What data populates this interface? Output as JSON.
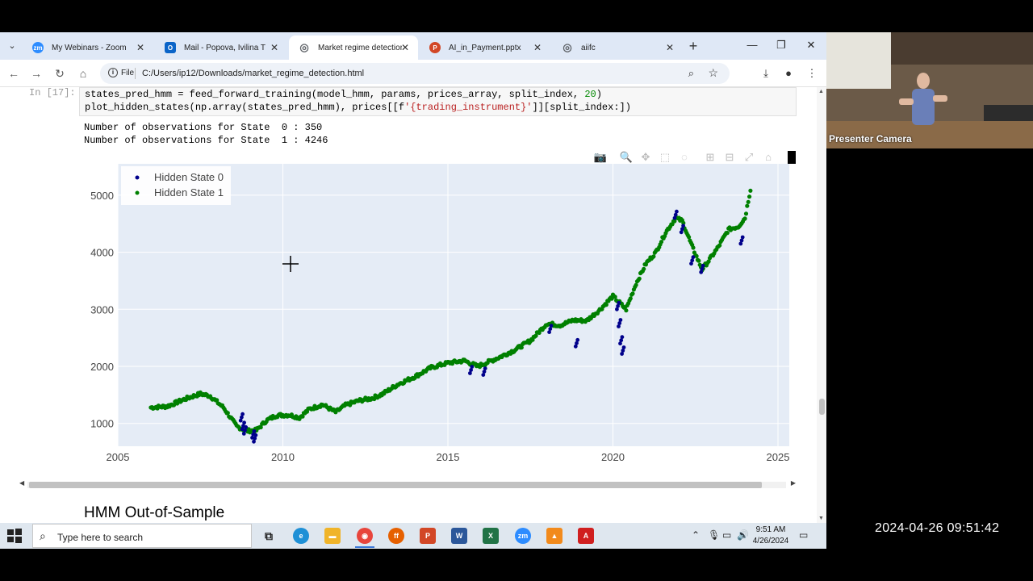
{
  "browser": {
    "tabs": [
      {
        "title": "My Webinars - Zoom",
        "icon": "zoom-icon",
        "color": "#2d8cff",
        "glyph": "zm"
      },
      {
        "title": "Mail - Popova, Ivilina T -",
        "icon": "outlook-icon",
        "color": "#0a64c8",
        "glyph": "O"
      },
      {
        "title": "Market regime detection",
        "icon": "globe-icon",
        "color": "#5f6368",
        "glyph": "◎",
        "active": true
      },
      {
        "title": "AI_in_Payment.pptx",
        "icon": "powerpoint-icon",
        "color": "#d24726",
        "glyph": "P"
      },
      {
        "title": "aiifc",
        "icon": "globe-icon",
        "color": "#5f6368",
        "glyph": "◎"
      }
    ],
    "site_label": "File",
    "url": "C:/Users/ip12/Downloads/market_regime_detection.html"
  },
  "notebook": {
    "prompt": "In [17]:",
    "code_line1_a": "states_pred_hmm = feed_forward_training(model_hmm, params, prices_array, split_index, ",
    "code_line1_num": "20",
    "code_line1_b": ")",
    "code_line2_a": "plot_hidden_states(np.array(states_pred_hmm), prices[[f",
    "code_line2_str": "'{trading_instrument}'",
    "code_line2_b": "]][split_index:])",
    "output": [
      "Number of observations for State  0 : 350",
      "Number of observations for State  1 : 4246"
    ],
    "section_heading": "HMM Out-of-Sample"
  },
  "chart_data": {
    "type": "scatter",
    "title": "",
    "xlabel": "",
    "ylabel": "",
    "xlim": [
      2005,
      2025
    ],
    "ylim": [
      600,
      5550
    ],
    "x_ticks": [
      "2005",
      "2010",
      "2015",
      "2020",
      "2025"
    ],
    "y_ticks": [
      "1000",
      "2000",
      "3000",
      "4000",
      "5000"
    ],
    "grid": true,
    "legend_position": "top-left",
    "series": [
      {
        "name": "Hidden State 1",
        "color": "#008000",
        "x": [
          2006.0,
          2006.5,
          2007.0,
          2007.5,
          2007.8,
          2008.2,
          2008.6,
          2008.9,
          2009.2,
          2009.5,
          2009.8,
          2010.2,
          2010.5,
          2010.8,
          2011.2,
          2011.6,
          2011.9,
          2012.3,
          2012.7,
          2013.0,
          2013.5,
          2014.0,
          2014.5,
          2015.0,
          2015.5,
          2015.9,
          2016.2,
          2016.6,
          2017.0,
          2017.5,
          2018.0,
          2018.4,
          2018.8,
          2019.2,
          2019.6,
          2020.0,
          2020.4,
          2020.7,
          2021.0,
          2021.3,
          2021.6,
          2021.9,
          2022.1,
          2022.4,
          2022.7,
          2022.9,
          2023.2,
          2023.5,
          2023.8,
          2024.0,
          2024.2
        ],
        "y": [
          1280,
          1300,
          1420,
          1520,
          1480,
          1280,
          950,
          870,
          880,
          1050,
          1140,
          1150,
          1100,
          1250,
          1330,
          1200,
          1320,
          1400,
          1440,
          1510,
          1690,
          1820,
          1980,
          2060,
          2100,
          2000,
          2070,
          2170,
          2280,
          2450,
          2750,
          2720,
          2810,
          2800,
          2990,
          3230,
          3000,
          3450,
          3800,
          4000,
          4350,
          4600,
          4550,
          4100,
          3700,
          3850,
          4100,
          4400,
          4450,
          4600,
          5200
        ]
      },
      {
        "name": "Hidden State 0",
        "color": "#00008b",
        "x": [
          2008.75,
          2008.8,
          2008.85,
          2009.1,
          2009.15,
          2015.7,
          2016.1,
          2018.1,
          2018.9,
          2020.15,
          2020.2,
          2020.25,
          2020.3,
          2021.9,
          2022.1,
          2022.4,
          2022.7,
          2023.9
        ],
        "y": [
          1050,
          900,
          820,
          750,
          680,
          1880,
          1850,
          2600,
          2350,
          3000,
          2700,
          2400,
          2220,
          4600,
          4350,
          3800,
          3650,
          4150
        ]
      }
    ]
  },
  "taskbar": {
    "search_placeholder": "Type here to search",
    "time": "9:51 AM",
    "date": "4/26/2024"
  },
  "camera": {
    "label": "Presenter Camera"
  },
  "timestamp": "2024-04-26 09:51:42"
}
